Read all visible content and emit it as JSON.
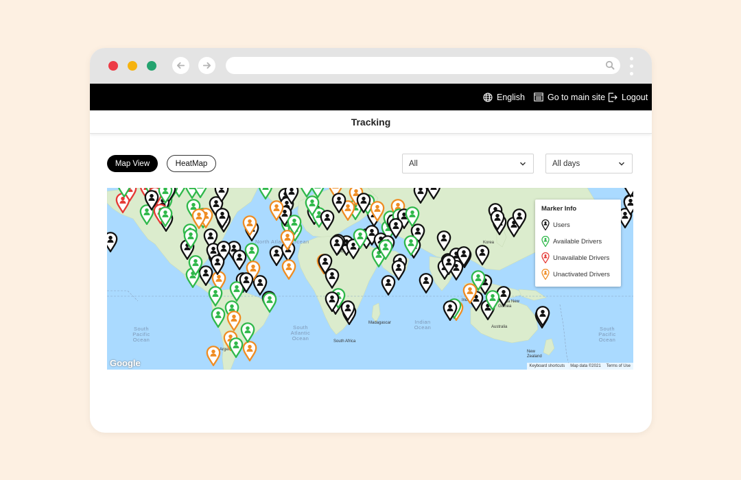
{
  "topbar": {
    "language": "English",
    "main_site": "Go to main site",
    "logout": "Logout"
  },
  "page": {
    "title": "Tracking"
  },
  "view_toggle": {
    "map_view": "Map View",
    "heatmap": "HeatMap",
    "active": "Map View"
  },
  "filters": {
    "type_selected": "All",
    "days_selected": "All days"
  },
  "map": {
    "ocean_labels": {
      "north_atlantic": "North Atlantic Ocean",
      "south_atlantic": "South Atlantic Ocean",
      "south_pacific_left": "South Pacific Ocean",
      "south_pacific_right": "South Pacific Ocean",
      "indian": "Indian Ocean"
    },
    "place_labels": {
      "libya": "Libya",
      "korea": "Korea",
      "argentina": "Argentina",
      "madagascar": "Madagascar",
      "south_africa": "South Africa",
      "papua": "Papua New Guinea",
      "indonesia": "Indonesia",
      "australia": "Australia",
      "new_zealand": "New Zealand"
    },
    "google_logo": "Google",
    "attribution": {
      "shortcuts": "Keyboard shortcuts",
      "data": "Map data ©2021",
      "terms": "Terms of Use"
    }
  },
  "legend": {
    "title": "Marker Info",
    "items": [
      {
        "label": "Users",
        "color": "#111111",
        "icon": "user-marker-icon"
      },
      {
        "label": "Available Drivers",
        "color": "#2fb84a",
        "icon": "available-driver-marker-icon"
      },
      {
        "label": "Unavailable Drivers",
        "color": "#e53935",
        "icon": "unavailable-driver-marker-icon"
      },
      {
        "label": "Unactivated Drivers",
        "color": "#ef8c22",
        "icon": "unactivated-driver-marker-icon"
      }
    ]
  },
  "colors": {
    "land": "#dbeccd",
    "water": "#aadaff",
    "user": "#111111",
    "available": "#2fb84a",
    "unavailable": "#e53935",
    "unactivated": "#ef8c22"
  }
}
